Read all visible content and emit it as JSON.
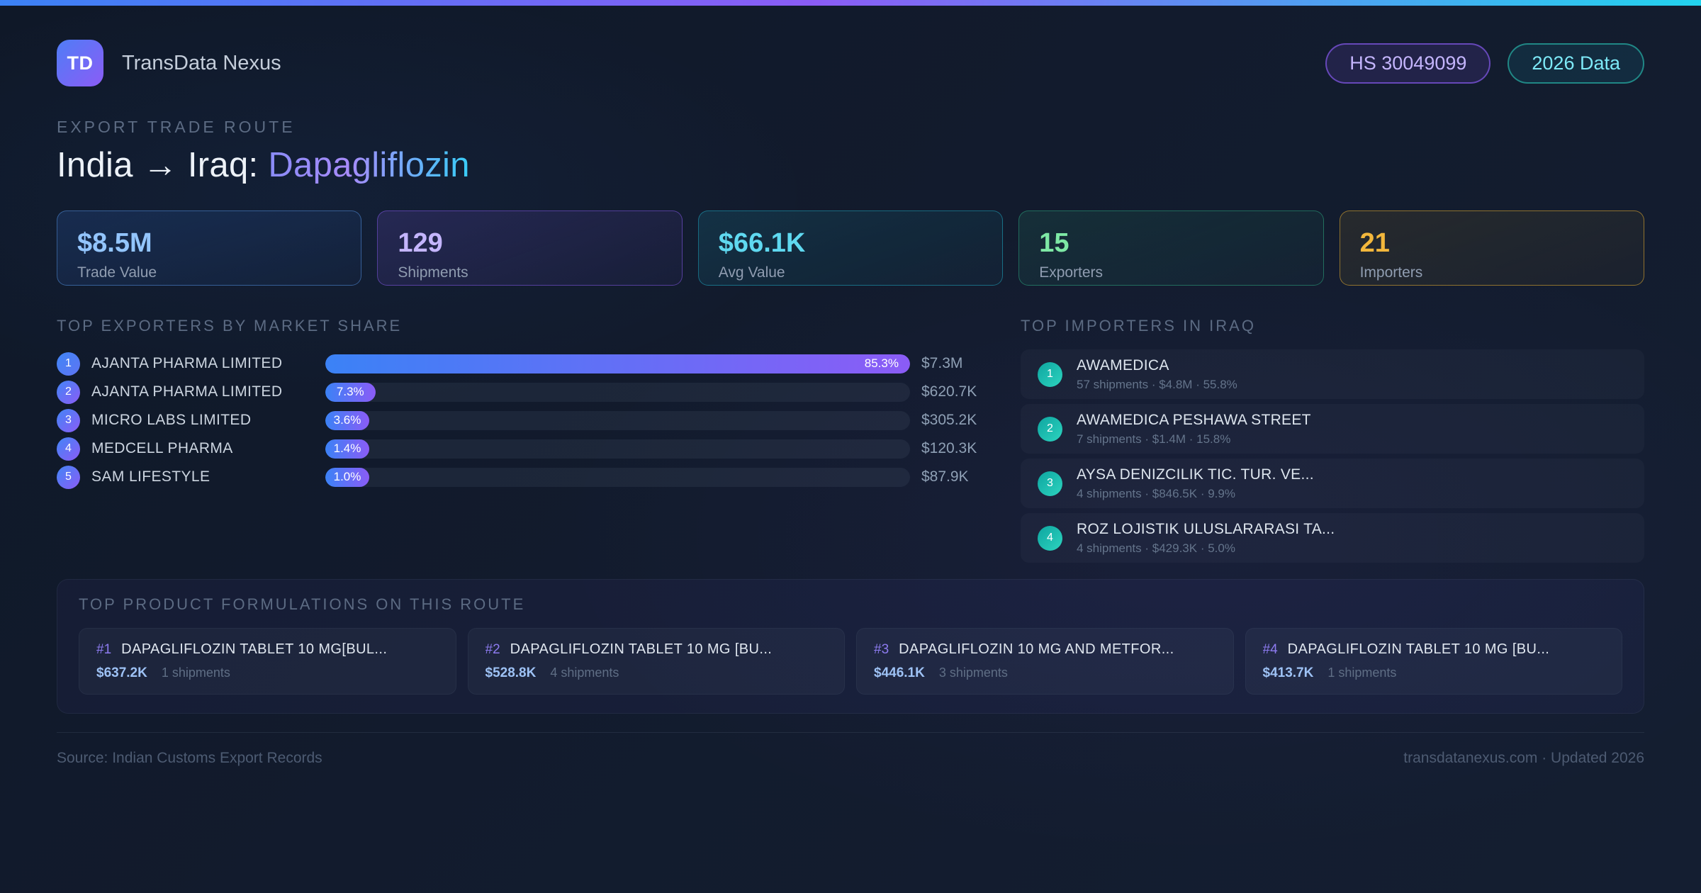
{
  "header": {
    "logo_text": "TD",
    "brand": "TransData Nexus",
    "badges": [
      {
        "label": "HS 30049099",
        "color": "#c4b5fd"
      },
      {
        "label": "2026 Data",
        "color": "#7de9f7"
      }
    ]
  },
  "hero": {
    "eyebrow": "EXPORT TRADE ROUTE",
    "title_prefix": "India → Iraq: ",
    "title_highlight": "Dapagliflozin"
  },
  "stats": [
    {
      "value": "$8.5M",
      "label": "Trade Value",
      "theme": "blue",
      "accent": "#93c5fd"
    },
    {
      "value": "129",
      "label": "Shipments",
      "theme": "purple",
      "accent": "#c4b5fd"
    },
    {
      "value": "$66.1K",
      "label": "Avg Value",
      "theme": "cyan",
      "accent": "#5fd9f0"
    },
    {
      "value": "15",
      "label": "Exporters",
      "theme": "green",
      "accent": "#7ee8a5"
    },
    {
      "value": "21",
      "label": "Importers",
      "theme": "amber",
      "accent": "#f3b73c"
    }
  ],
  "exporters": {
    "heading": "TOP EXPORTERS BY MARKET SHARE",
    "max_share_pct": 85.3,
    "bar_gradient": [
      "#3b82f6",
      "#8b5cf6"
    ],
    "rows": [
      {
        "rank": "1",
        "name": "AJANTA PHARMA LIMITED",
        "share_label": "85.3%",
        "share_pct": 85.3,
        "value": "$7.3M"
      },
      {
        "rank": "2",
        "name": "AJANTA PHARMA LIMITED",
        "share_label": "7.3%",
        "share_pct": 7.3,
        "value": "$620.7K"
      },
      {
        "rank": "3",
        "name": "MICRO LABS LIMITED",
        "share_label": "3.6%",
        "share_pct": 3.6,
        "value": "$305.2K"
      },
      {
        "rank": "4",
        "name": "MEDCELL PHARMA",
        "share_label": "1.4%",
        "share_pct": 1.4,
        "value": "$120.3K"
      },
      {
        "rank": "5",
        "name": "SAM LIFESTYLE",
        "share_label": "1.0%",
        "share_pct": 1.0,
        "value": "$87.9K"
      }
    ]
  },
  "importers": {
    "heading": "TOP IMPORTERS IN IRAQ",
    "rank_color": "#2dd4bf",
    "rows": [
      {
        "rank": "1",
        "name": "AWAMEDICA",
        "meta": "57 shipments · $4.8M · 55.8%"
      },
      {
        "rank": "2",
        "name": "AWAMEDICA PESHAWA STREET",
        "meta": "7 shipments · $1.4M · 15.8%"
      },
      {
        "rank": "3",
        "name": "AYSA DENIZCILIK TIC. TUR. VE...",
        "meta": "4 shipments · $846.5K · 9.9%"
      },
      {
        "rank": "4",
        "name": "ROZ LOJISTIK ULUSLARARASI TA...",
        "meta": "4 shipments · $429.3K · 5.0%"
      }
    ]
  },
  "products": {
    "heading": "TOP PRODUCT FORMULATIONS ON THIS ROUTE",
    "cards": [
      {
        "rank": "#1",
        "name": "DAPAGLIFLOZIN TABLET 10 MG[BUL...",
        "value": "$637.2K",
        "shipments": "1 shipments"
      },
      {
        "rank": "#2",
        "name": "DAPAGLIFLOZIN TABLET 10 MG [BU...",
        "value": "$528.8K",
        "shipments": "4 shipments"
      },
      {
        "rank": "#3",
        "name": "DAPAGLIFLOZIN 10 MG AND METFOR...",
        "value": "$446.1K",
        "shipments": "3 shipments"
      },
      {
        "rank": "#4",
        "name": "DAPAGLIFLOZIN TABLET 10 MG [BU...",
        "value": "$413.7K",
        "shipments": "1 shipments"
      }
    ]
  },
  "footer": {
    "source": "Source: Indian Customs Export Records",
    "site": "transdatanexus.com · Updated 2026"
  }
}
